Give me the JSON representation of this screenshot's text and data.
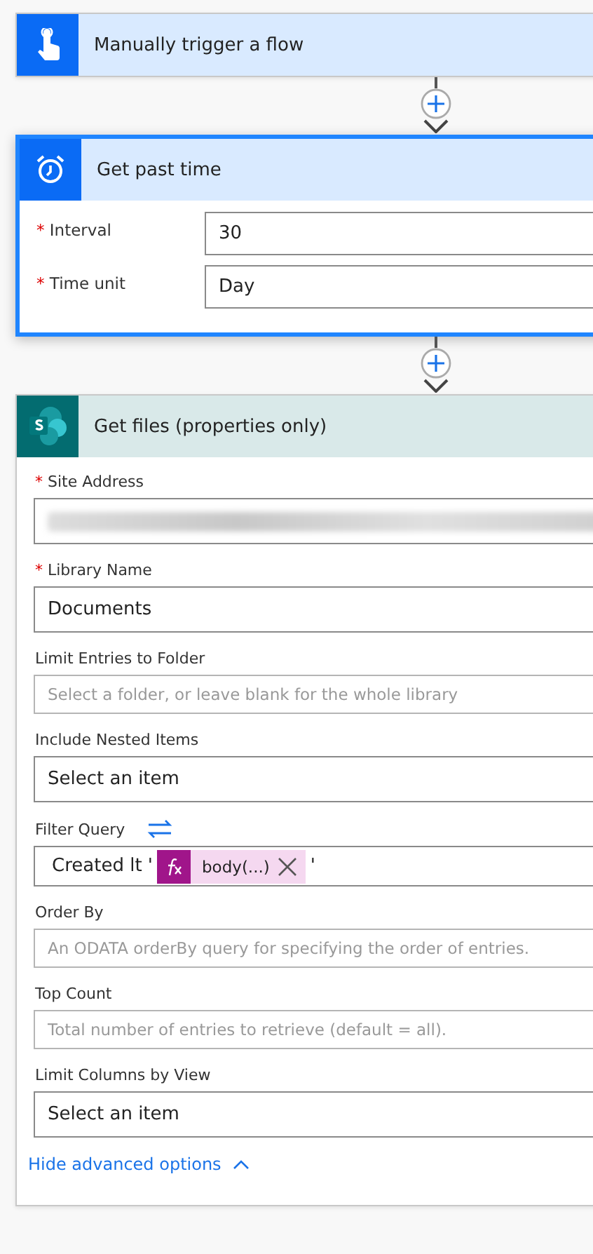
{
  "cards": [
    {
      "kind": "trigger",
      "title": "Manually trigger a flow",
      "selected": false
    },
    {
      "kind": "clock",
      "title": "Get past time",
      "selected": true,
      "fields": [
        {
          "kind": "text",
          "marker": "*",
          "label": "Interval",
          "value": "30"
        },
        {
          "kind": "text",
          "marker": "*",
          "label": "Time unit",
          "value": "Day"
        }
      ]
    },
    {
      "kind": "sharepoint",
      "title": "Get files (properties only)",
      "selected": false,
      "fields": [
        {
          "kind": "redacted",
          "marker": "*",
          "label": "Site Address"
        },
        {
          "kind": "text",
          "marker": "*",
          "label": "Library Name",
          "value": "Documents"
        },
        {
          "kind": "text",
          "label": "Limit Entries to Folder",
          "placeholder": "Select a folder, or leave blank for the whole library"
        },
        {
          "kind": "text",
          "label": "Include Nested Items",
          "value": "Select an item"
        },
        {
          "kind": "expression",
          "label": "Filter Query",
          "parts": [
            {
              "kind": "text",
              "text": "Created lt '"
            },
            {
              "kind": "token",
              "text": "body(...)"
            },
            {
              "kind": "text",
              "text": "'"
            }
          ]
        },
        {
          "kind": "text",
          "label": "Order By",
          "placeholder": "An ODATA orderBy query for specifying the order of entries."
        },
        {
          "kind": "text",
          "label": "Top Count",
          "placeholder": "Total number of entries to retrieve (default = all)."
        },
        {
          "kind": "text",
          "label": "Limit Columns by View",
          "value": "Select an item"
        }
      ],
      "link": "Hide advanced options"
    }
  ]
}
